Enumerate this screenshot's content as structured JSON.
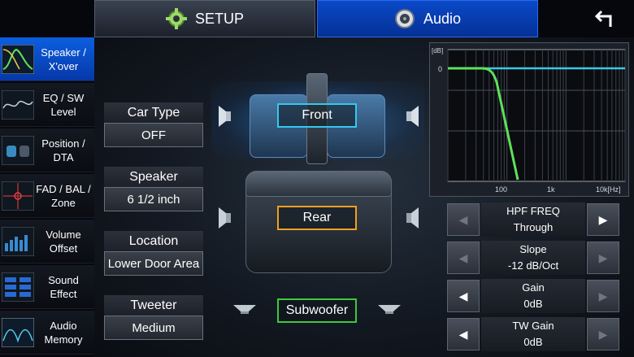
{
  "tabs": {
    "setup": "SETUP",
    "audio": "Audio"
  },
  "sidebar": {
    "items": [
      {
        "label": "Speaker /\nX'over",
        "active": true,
        "icon": "xover-thumb-icon"
      },
      {
        "label": "EQ / SW\nLevel",
        "active": false,
        "icon": "eq-thumb-icon"
      },
      {
        "label": "Position /\nDTA",
        "active": false,
        "icon": "position-thumb-icon"
      },
      {
        "label": "FAD / BAL /\nZone",
        "active": false,
        "icon": "fader-thumb-icon"
      },
      {
        "label": "Volume\nOffset",
        "active": false,
        "icon": "volume-thumb-icon"
      },
      {
        "label": "Sound\nEffect",
        "active": false,
        "icon": "effect-thumb-icon"
      },
      {
        "label": "Audio\nMemory",
        "active": false,
        "icon": "memory-thumb-icon"
      }
    ]
  },
  "params": {
    "car_type": {
      "label": "Car Type",
      "value": "OFF"
    },
    "speaker": {
      "label": "Speaker",
      "value": "6 1/2 inch"
    },
    "location": {
      "label": "Location",
      "value": "Lower Door Area"
    },
    "tweeter": {
      "label": "Tweeter",
      "value": "Medium"
    }
  },
  "zones": {
    "front": "Front",
    "rear": "Rear",
    "subwoofer": "Subwoofer"
  },
  "graph": {
    "y_unit": "[dB]",
    "y_zero": "0",
    "x_ticks": [
      "100",
      "1k",
      "10k[Hz]"
    ],
    "curve_color": "#5fe05a",
    "flat_color": "#3cc8e0"
  },
  "controls": [
    {
      "name": "HPF FREQ",
      "value": "Through",
      "left_enabled": false,
      "right_enabled": true
    },
    {
      "name": "Slope",
      "value": "-12 dB/Oct",
      "left_enabled": false,
      "right_enabled": false
    },
    {
      "name": "Gain",
      "value": "0dB",
      "left_enabled": true,
      "right_enabled": false
    },
    {
      "name": "TW Gain",
      "value": "0dB",
      "left_enabled": true,
      "right_enabled": false
    }
  ]
}
